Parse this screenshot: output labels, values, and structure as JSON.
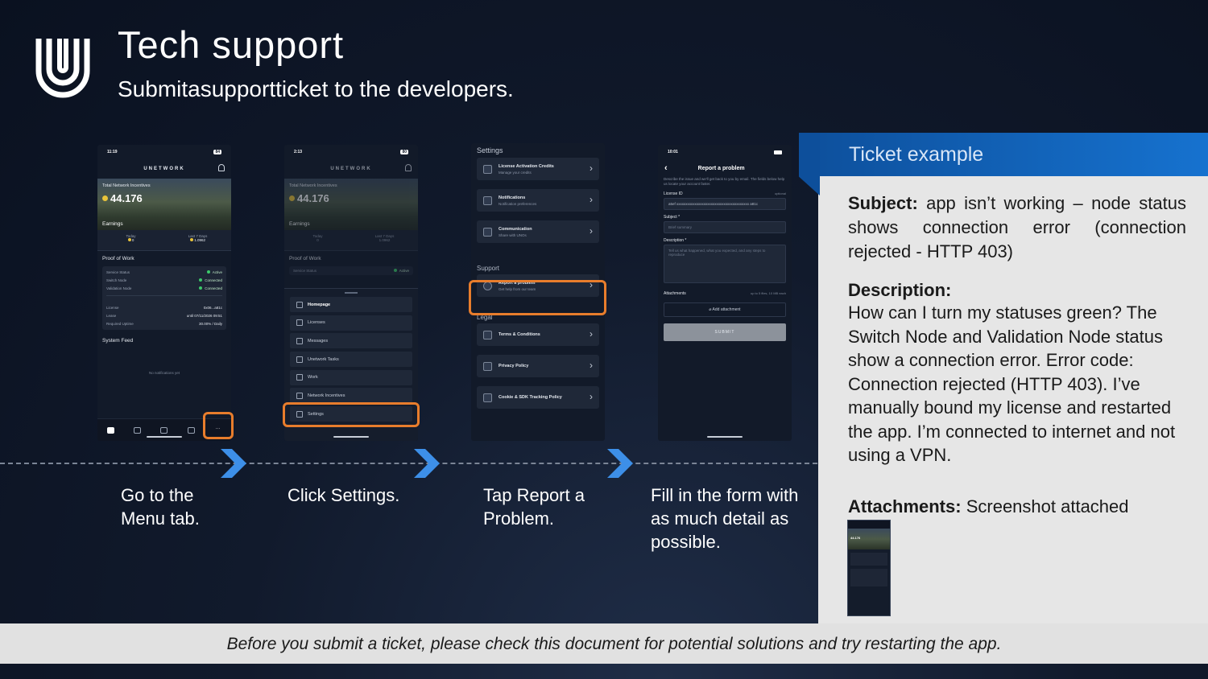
{
  "header": {
    "title": "Tech support",
    "subtitle": "Submitasupportticket to the developers."
  },
  "phone1": {
    "time": "11:19",
    "battery": "84",
    "brand": "UNETWORK",
    "hero_label": "Total Network Incentives",
    "hero_value": "44.176",
    "earnings_label": "Earnings",
    "today_label": "Today",
    "today_value": "0",
    "last7_label": "Last 7 Days",
    "last7_value": "1.0962",
    "pow_label": "Proof of Work",
    "status_rows": [
      {
        "label": "Service Status",
        "value": "Active"
      },
      {
        "label": "Switch Node",
        "value": "Connected"
      },
      {
        "label": "Validation Node",
        "value": "Connected"
      }
    ],
    "license_rows": [
      {
        "label": "License",
        "value": "0x06...a81c"
      },
      {
        "label": "Lease",
        "value": "until 07/11/2026 09:51"
      },
      {
        "label": "Required Uptime",
        "value": "30.00% / Daily"
      }
    ],
    "feed_label": "System Feed",
    "feed_empty": "No notifications yet"
  },
  "phone2": {
    "time": "2:13",
    "battery": "80",
    "brand": "UNETWORK",
    "hero_label": "Total Network Incentives",
    "hero_value": "44.176",
    "earnings_label": "Earnings",
    "today_label": "Today",
    "today_value": "0",
    "last7_label": "Last 7 Days",
    "last7_value": "1.0962",
    "pow_label": "Proof of Work",
    "service_status_label": "Service Status",
    "service_status_value": "Active",
    "menu_items": [
      "Homepage",
      "Licenses",
      "Messages",
      "Unetwork Tasks",
      "Work",
      "Network Incentives",
      "Settings"
    ]
  },
  "phone3": {
    "settings_title": "Settings",
    "settings_items": [
      {
        "label": "License Activation Credits",
        "sub": "Manage your credits"
      },
      {
        "label": "Notifications",
        "sub": "Notification preferences"
      },
      {
        "label": "Communication",
        "sub": "Share with UNOs"
      }
    ],
    "support_title": "Support",
    "support_item": {
      "label": "Report a problem",
      "sub": "Get help from our team"
    },
    "legal_title": "Legal",
    "legal_items": [
      {
        "label": "Terms & Conditions"
      },
      {
        "label": "Privacy Policy"
      },
      {
        "label": "Cookie & SDK Tracking Policy"
      }
    ]
  },
  "phone4": {
    "time": "10:01",
    "title": "Report a problem",
    "intro": "Describe the issue and we'll get back to you by email. The fields below help us locate your account faster.",
    "license_label": "License ID",
    "license_optional": "optional",
    "license_value": "a5ef xxxxxxxxxxxxxxxxxxxxxxxxxxxxxxxxxxxxxxxx a81c",
    "subject_label": "Subject *",
    "subject_placeholder": "Brief summary",
    "description_label": "Description *",
    "description_placeholder": "Tell us what happened, what you expected, and any steps to reproduce",
    "attachments_label": "Attachments",
    "attachments_note": "up to 5 files, 10 MB each",
    "add_attachment": "Add attachment",
    "submit_label": "SUBMIT"
  },
  "steps": [
    "Go to the Menu tab.",
    "Click Settings.",
    "Tap Report a Problem.",
    "Fill in the form with as much detail as possible."
  ],
  "ticket": {
    "title": "Ticket example",
    "subject_label": "Subject:",
    "subject_text": "app isn’t working – node status shows connection error (connection rejected - HTTP 403)",
    "description_label": "Description:",
    "description_text": "How can I turn my statuses green? The Switch Node and Validation Node status show a connection error. Error code: Connection rejected (HTTP 403). I’ve manually bound my license and restarted the app. I’m connected to internet and not using a VPN.",
    "attachments_label": "Attachments:",
    "attachments_text": "Screenshot attached",
    "thumb_value": "44.176"
  },
  "footer": {
    "note": "Before you submit a ticket, please check this document for potential solutions and try restarting the app."
  },
  "colors": {
    "highlight": "#e87d2c",
    "accent_blue": "#1672cf",
    "chevron": "#3d8fe8"
  }
}
